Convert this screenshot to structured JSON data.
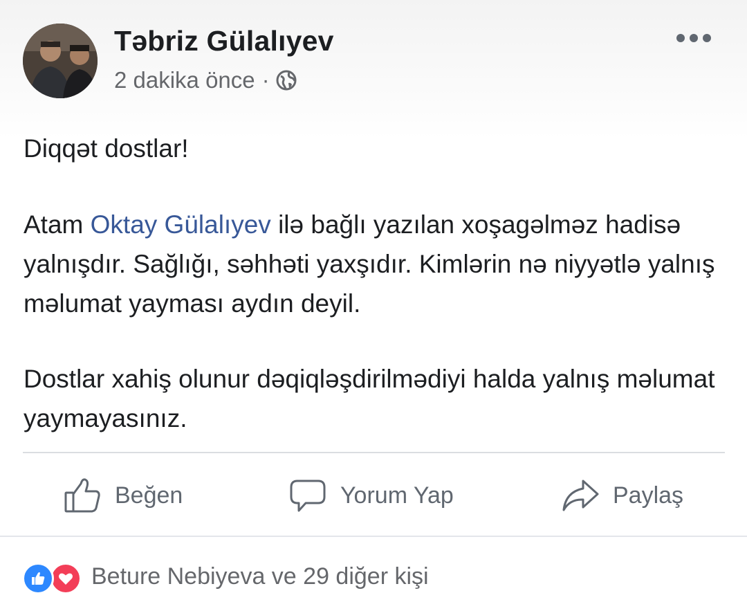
{
  "post": {
    "author": "Təbriz Gülalıyev",
    "timestamp": "2 dakika önce",
    "separator": "·",
    "privacy_icon": "globe-icon",
    "more_icon": "more-dots-icon",
    "text": {
      "p1": "Diqqət dostlar!",
      "p2_before": "Atam ",
      "p2_mention": "Oktay Gülalıyev",
      "p2_after": " ilə bağlı yazılan xoşagəlməz hadisə yalnışdır. Sağlığı, səhhəti yaxşıdır. Kimlərin nə niyyətlə yalnış məlumat yayması aydın deyil.",
      "p3": "Dostlar xahiş olunur dəqiqləşdirilmədiyi halda yalnış məlumat yaymayasınız."
    }
  },
  "actions": {
    "like": {
      "label": "Beğen",
      "icon": "thumbs-up-icon"
    },
    "comment": {
      "label": "Yorum Yap",
      "icon": "comment-bubble-icon"
    },
    "share": {
      "label": "Paylaş",
      "icon": "share-arrow-icon"
    }
  },
  "reactions": {
    "summary": "Beture Nebiyeva ve 29 diğer kişi",
    "icons": [
      "like-reaction-icon",
      "love-reaction-icon"
    ]
  },
  "colors": {
    "link": "#385898",
    "secondary_text": "#65676b",
    "like_blue": "#2d88ff",
    "love_red": "#f33e58"
  }
}
